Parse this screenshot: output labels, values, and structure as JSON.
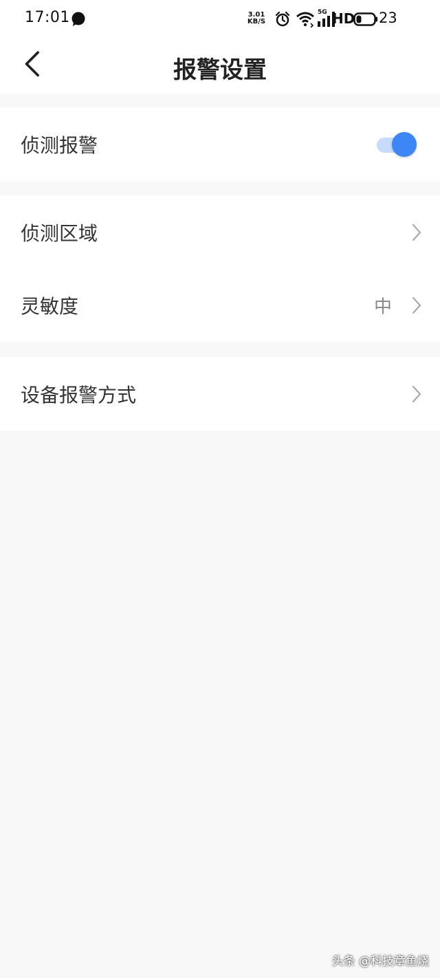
{
  "status_bar": {
    "time": "17:01",
    "net_speed_value": "3.01",
    "net_speed_unit": "KB/S",
    "network_label": "5G",
    "hd_label": "HD",
    "battery_level": "23"
  },
  "header": {
    "title": "报警设置"
  },
  "settings": {
    "detect_alarm": {
      "label": "侦测报警",
      "enabled": true
    },
    "detect_area": {
      "label": "侦测区域"
    },
    "sensitivity": {
      "label": "灵敏度",
      "value": "中"
    },
    "device_alarm_mode": {
      "label": "设备报警方式"
    }
  },
  "watermark": "头条 @科技章鱼烧"
}
